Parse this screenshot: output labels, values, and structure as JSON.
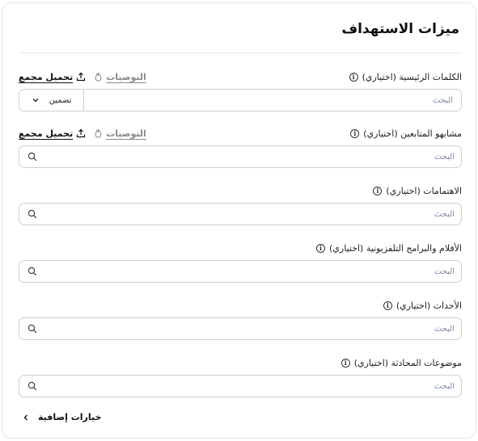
{
  "title": "ميزات الاستهداف",
  "actions": {
    "upload_label": "تحميل مجمع",
    "reco_label": "التوصيات"
  },
  "fields": [
    {
      "label": "الكلمات الرئيسية (اختياري)",
      "placeholder": "البحث",
      "match_type": "تضمين"
    },
    {
      "label": "مشابهو المتابعين (اختياري)",
      "placeholder": "البحث"
    },
    {
      "label": "الاهتمامات (اختياري)",
      "placeholder": "البحث"
    },
    {
      "label": "الأفلام والبرامج التلفزيونية (اختياري)",
      "placeholder": "البحث"
    },
    {
      "label": "الأحداث (اختياري)",
      "placeholder": "البحث"
    },
    {
      "label": "موضوعات المحادثة (اختياري)",
      "placeholder": "البحث"
    }
  ],
  "more_options_label": "خيارات إضافية",
  "icons": {
    "info": "info-icon",
    "upload": "upload-icon",
    "recommendations": "flame-icon",
    "search": "search-icon",
    "dropdown": "chevron-down-icon",
    "expand": "chevron-left-icon"
  },
  "colors": {
    "text": "#111111",
    "muted_link": "#8a8a8a",
    "placeholder": "#7b8aa8",
    "border": "#cfcfcf"
  }
}
